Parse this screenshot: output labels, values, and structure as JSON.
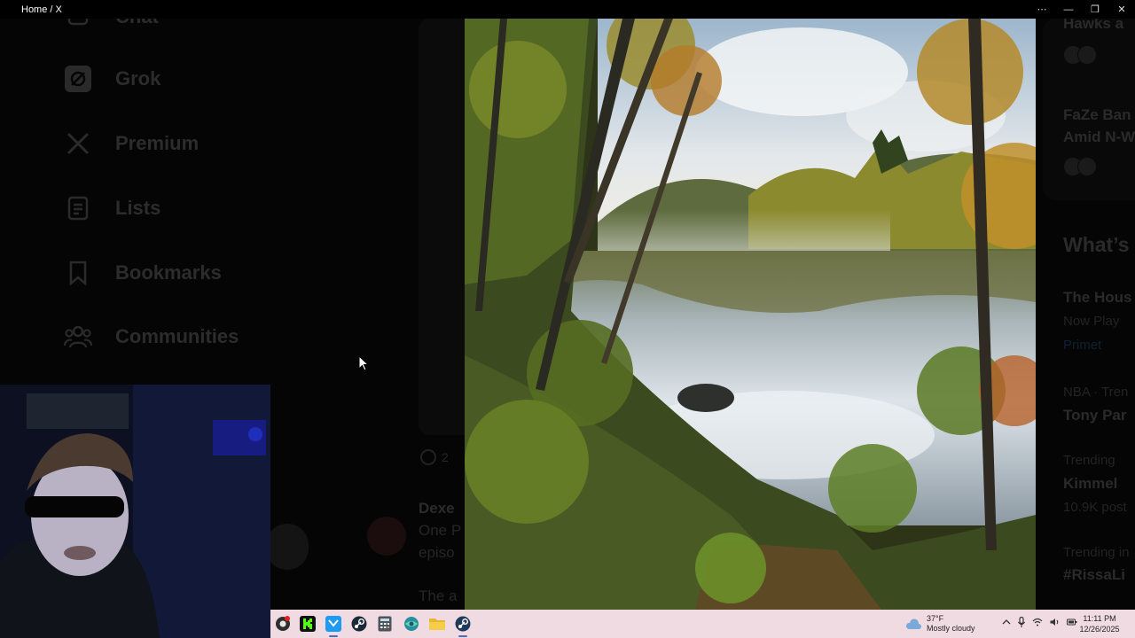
{
  "window": {
    "title": "Home / X",
    "controls": [
      "⋯",
      "—",
      "❐",
      "✕"
    ]
  },
  "sidebar": {
    "items": [
      {
        "label": "Chat",
        "icon": "chat-icon"
      },
      {
        "label": "Grok",
        "icon": "grok-icon"
      },
      {
        "label": "Premium",
        "icon": "x-logo-icon"
      },
      {
        "label": "Lists",
        "icon": "list-icon"
      },
      {
        "label": "Bookmarks",
        "icon": "bookmark-icon"
      },
      {
        "label": "Communities",
        "icon": "communities-icon"
      }
    ]
  },
  "feed": {
    "reply_count": "2",
    "post": {
      "author": "Dexe",
      "line1": "One P",
      "line2": "episo",
      "line3": "The a"
    }
  },
  "trends": {
    "items": [
      {
        "text": "Hawks a"
      },
      {
        "text": "FaZe Ban"
      },
      {
        "text": "Amid N-W"
      },
      {
        "text": "What’s"
      },
      {
        "text": "The Hous"
      },
      {
        "text": "Now Play"
      },
      {
        "text": "Primet"
      },
      {
        "text": "NBA · Tren"
      },
      {
        "text": "Tony Par"
      },
      {
        "text": "Trending"
      },
      {
        "text": "Kimmel"
      },
      {
        "text": "10.9K post"
      },
      {
        "text": "Trending in"
      },
      {
        "text": "#RissaLi"
      }
    ]
  },
  "taskbar": {
    "apps": [
      "chrome-icon",
      "kick-icon",
      "x-twitter-icon",
      "steam-icon",
      "calculator-icon",
      "browser-icon",
      "file-explorer-icon",
      "steam-alt-icon"
    ],
    "weather": {
      "temp": "37°F",
      "condition": "Mostly cloudy"
    },
    "clock": {
      "time": "11:11 PM",
      "date": "12/26/2025"
    }
  }
}
